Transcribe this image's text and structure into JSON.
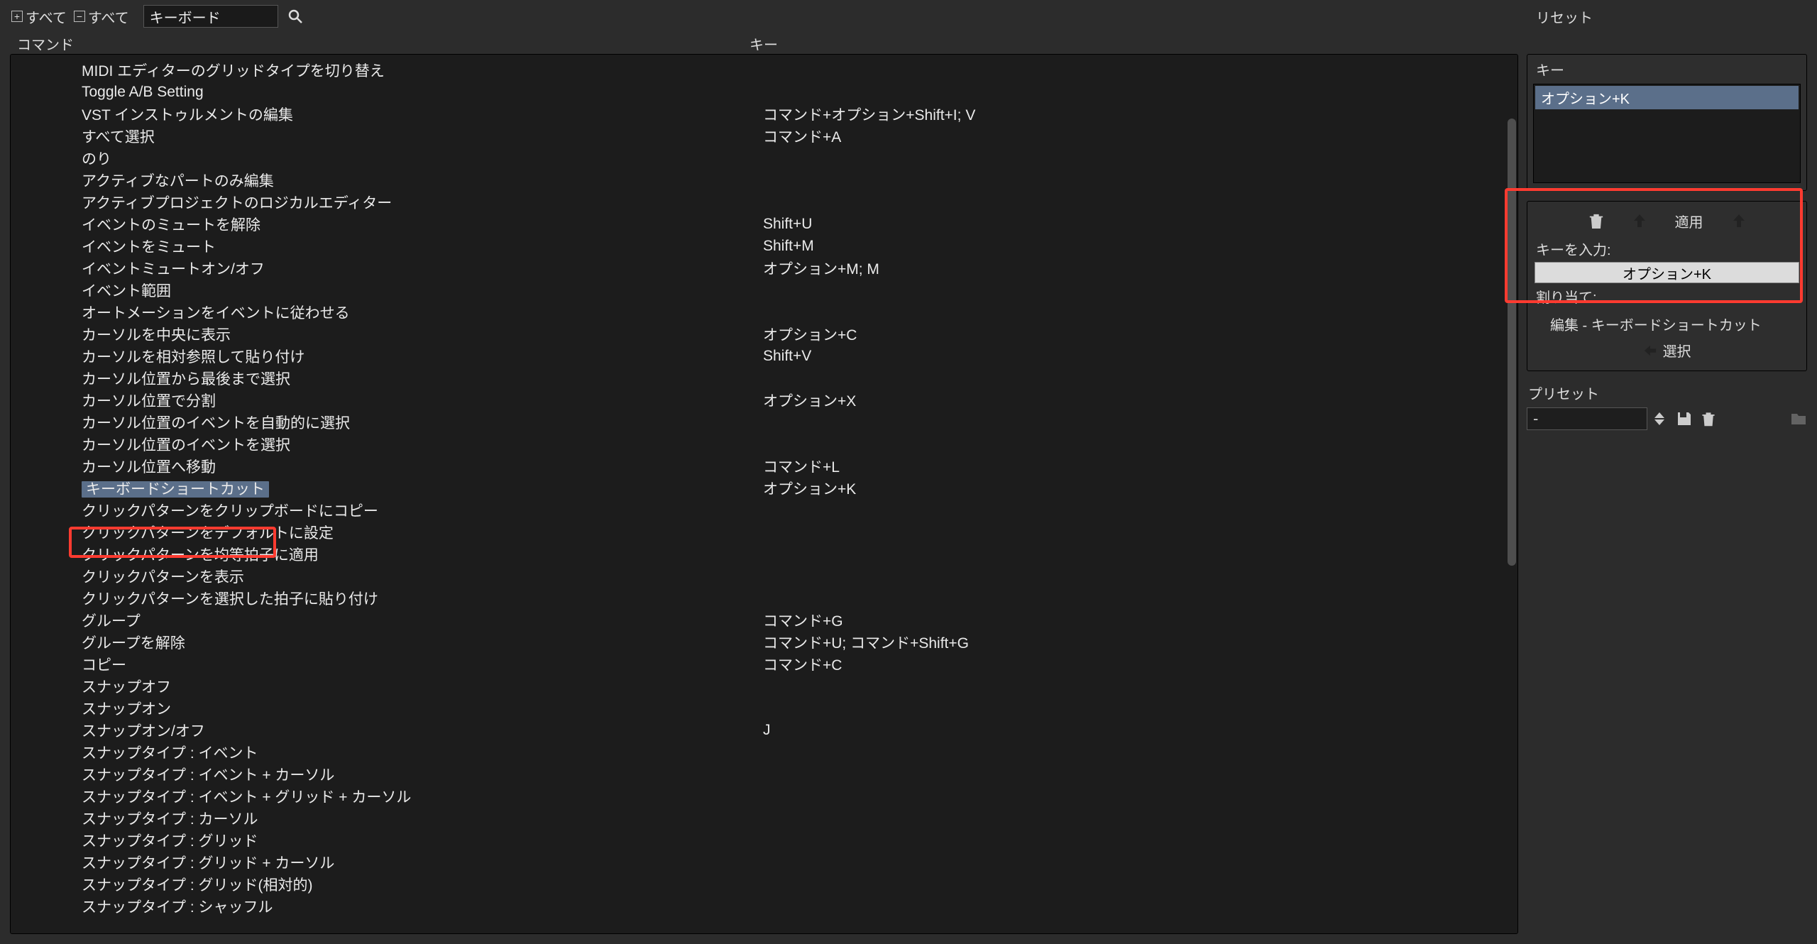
{
  "toolbar": {
    "expand_all": "すべて",
    "collapse_all": "すべて",
    "search_value": "キーボード",
    "reset": "リセット"
  },
  "columns": {
    "command": "コマンド",
    "key": "キー"
  },
  "rows": [
    {
      "cmd": "MIDI エディターのグリッドタイプを切り替え",
      "key": ""
    },
    {
      "cmd": "Toggle A/B Setting",
      "key": ""
    },
    {
      "cmd": "VST インストゥルメントの編集",
      "key": "コマンド+オプション+Shift+I; V"
    },
    {
      "cmd": "すべて選択",
      "key": "コマンド+A"
    },
    {
      "cmd": "のり",
      "key": ""
    },
    {
      "cmd": "アクティブなパートのみ編集",
      "key": ""
    },
    {
      "cmd": "アクティブプロジェクトのロジカルエディター",
      "key": ""
    },
    {
      "cmd": "イベントのミュートを解除",
      "key": "Shift+U"
    },
    {
      "cmd": "イベントをミュート",
      "key": "Shift+M"
    },
    {
      "cmd": "イベントミュートオン/オフ",
      "key": "オプション+M; M"
    },
    {
      "cmd": "イベント範囲",
      "key": ""
    },
    {
      "cmd": "オートメーションをイベントに従わせる",
      "key": ""
    },
    {
      "cmd": "カーソルを中央に表示",
      "key": "オプション+C"
    },
    {
      "cmd": "カーソルを相対参照して貼り付け",
      "key": "Shift+V"
    },
    {
      "cmd": "カーソル位置から最後まで選択",
      "key": ""
    },
    {
      "cmd": "カーソル位置で分割",
      "key": "オプション+X"
    },
    {
      "cmd": "カーソル位置のイベントを自動的に選択",
      "key": ""
    },
    {
      "cmd": "カーソル位置のイベントを選択",
      "key": ""
    },
    {
      "cmd": "カーソル位置へ移動",
      "key": "コマンド+L"
    },
    {
      "cmd": "キーボードショートカット",
      "key": "オプション+K",
      "selected": true
    },
    {
      "cmd": "クリックパターンをクリップボードにコピー",
      "key": ""
    },
    {
      "cmd": "クリックパターンをデフォルトに設定",
      "key": ""
    },
    {
      "cmd": "クリックパターンを均等拍子に適用",
      "key": ""
    },
    {
      "cmd": "クリックパターンを表示",
      "key": ""
    },
    {
      "cmd": "クリックパターンを選択した拍子に貼り付け",
      "key": ""
    },
    {
      "cmd": "グループ",
      "key": "コマンド+G"
    },
    {
      "cmd": "グループを解除",
      "key": "コマンド+U; コマンド+Shift+G"
    },
    {
      "cmd": "コピー",
      "key": "コマンド+C"
    },
    {
      "cmd": "スナップオフ",
      "key": ""
    },
    {
      "cmd": "スナップオン",
      "key": ""
    },
    {
      "cmd": "スナップオン/オフ",
      "key": "J"
    },
    {
      "cmd": "スナップタイプ : イベント",
      "key": ""
    },
    {
      "cmd": "スナップタイプ : イベント + カーソル",
      "key": ""
    },
    {
      "cmd": "スナップタイプ : イベント + グリッド + カーソル",
      "key": ""
    },
    {
      "cmd": "スナップタイプ : カーソル",
      "key": ""
    },
    {
      "cmd": "スナップタイプ : グリッド",
      "key": ""
    },
    {
      "cmd": "スナップタイプ : グリッド + カーソル",
      "key": ""
    },
    {
      "cmd": "スナップタイプ : グリッド(相対的)",
      "key": ""
    },
    {
      "cmd": "スナップタイプ : シャッフル",
      "key": ""
    }
  ],
  "side": {
    "keys_header": "キー",
    "assigned_key": "オプション+K",
    "apply_label": "適用",
    "key_input_label": "キーを入力:",
    "key_input_value": "オプション+K",
    "assigned_label": "割り当て:",
    "assigned_to": "編集 - キーボードショートカット",
    "select_label": "選択"
  },
  "preset": {
    "label": "プリセット",
    "value": "-"
  }
}
